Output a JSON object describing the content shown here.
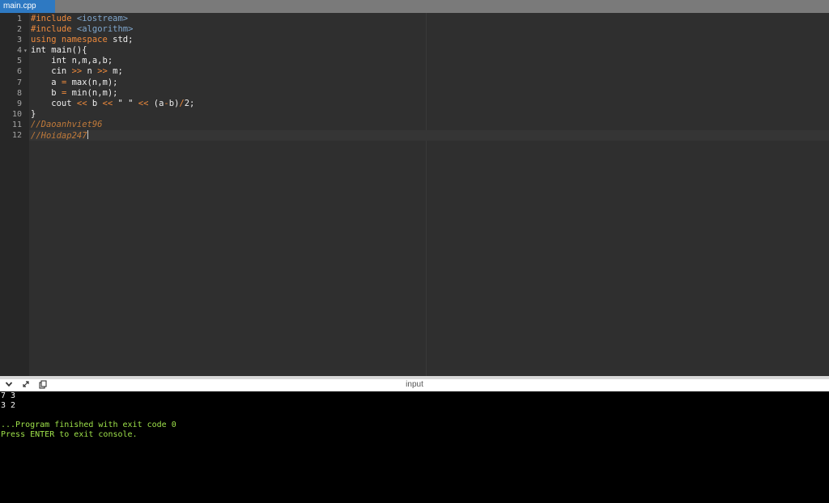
{
  "tab": {
    "label": "main.cpp"
  },
  "editor": {
    "lines": [
      {
        "no": "1",
        "tokens": [
          {
            "c": "kw",
            "t": "#include "
          },
          {
            "c": "inc",
            "t": "<iostream>"
          }
        ]
      },
      {
        "no": "2",
        "tokens": [
          {
            "c": "kw",
            "t": "#include "
          },
          {
            "c": "inc",
            "t": "<algorithm>"
          }
        ]
      },
      {
        "no": "3",
        "tokens": [
          {
            "c": "kw",
            "t": "using namespace "
          },
          {
            "c": "",
            "t": "std;"
          }
        ]
      },
      {
        "no": "4",
        "fold": true,
        "tokens": [
          {
            "c": "",
            "t": "int main(){"
          }
        ]
      },
      {
        "no": "5",
        "tokens": [
          {
            "c": "",
            "t": "    int n,m,a,b;"
          }
        ]
      },
      {
        "no": "6",
        "tokens": [
          {
            "c": "",
            "t": "    cin "
          },
          {
            "c": "op",
            "t": ">>"
          },
          {
            "c": "",
            "t": " n "
          },
          {
            "c": "op",
            "t": ">>"
          },
          {
            "c": "",
            "t": " m;"
          }
        ]
      },
      {
        "no": "7",
        "tokens": [
          {
            "c": "",
            "t": "    a "
          },
          {
            "c": "op",
            "t": "="
          },
          {
            "c": "",
            "t": " max(n,m);"
          }
        ]
      },
      {
        "no": "8",
        "tokens": [
          {
            "c": "",
            "t": "    b "
          },
          {
            "c": "op",
            "t": "="
          },
          {
            "c": "",
            "t": " min(n,m);"
          }
        ]
      },
      {
        "no": "9",
        "tokens": [
          {
            "c": "",
            "t": "    cout "
          },
          {
            "c": "op",
            "t": "<<"
          },
          {
            "c": "",
            "t": " b "
          },
          {
            "c": "op",
            "t": "<<"
          },
          {
            "c": "str",
            "t": " \" \" "
          },
          {
            "c": "op",
            "t": "<<"
          },
          {
            "c": "",
            "t": " (a"
          },
          {
            "c": "op",
            "t": "-"
          },
          {
            "c": "",
            "t": "b)"
          },
          {
            "c": "op",
            "t": "/"
          },
          {
            "c": "",
            "t": "2;"
          }
        ]
      },
      {
        "no": "10",
        "tokens": [
          {
            "c": "",
            "t": "}"
          }
        ]
      },
      {
        "no": "11",
        "tokens": [
          {
            "c": "cm",
            "t": "//Daoanhviet96"
          }
        ]
      },
      {
        "no": "12",
        "caret": true,
        "tokens": [
          {
            "c": "cm",
            "t": "//Hoidap247"
          }
        ]
      }
    ]
  },
  "panel": {
    "title": "input",
    "icons": [
      "chevron-down-icon",
      "expand-icon",
      "copy-icon"
    ]
  },
  "console": {
    "lines": [
      {
        "text": "7 3",
        "green": false
      },
      {
        "text": "3 2",
        "green": false
      },
      {
        "text": "",
        "green": false
      },
      {
        "text": "...Program finished with exit code 0",
        "green": true
      },
      {
        "text": "Press ENTER to exit console.",
        "green": true
      }
    ]
  },
  "colors": {
    "tab_active": "#2e79c2",
    "editor_bg": "#2f2f2f",
    "keyword": "#ee8a3c",
    "include": "#7fa6cc",
    "comment": "#c07a3a",
    "console_green": "#9ee24a"
  }
}
